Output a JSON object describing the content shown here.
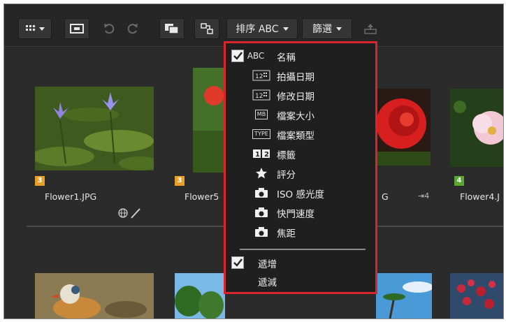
{
  "toolbar": {
    "sort_label": "排序 ABC",
    "filter_label": "篩選"
  },
  "sort_menu": {
    "options": [
      {
        "icon": "abc-icon",
        "icon_text": "ABC",
        "label": "名稱",
        "checked": true
      },
      {
        "icon": "calendar-icon",
        "icon_text": "12",
        "label": "拍攝日期",
        "checked": false
      },
      {
        "icon": "calendar-icon",
        "icon_text": "12",
        "label": "修改日期",
        "checked": false
      },
      {
        "icon": "filesize-icon",
        "icon_text": "MB",
        "label": "檔案大小",
        "checked": false
      },
      {
        "icon": "filetype-icon",
        "icon_text": "TYPE",
        "label": "檔案類型",
        "checked": false
      },
      {
        "icon": "label-icon",
        "icon_text": "12",
        "label": "標籤",
        "checked": false
      },
      {
        "icon": "star-icon",
        "icon_text": "",
        "label": "評分",
        "checked": false
      },
      {
        "icon": "camera-icon",
        "icon_text": "",
        "label": "ISO 感光度",
        "checked": false
      },
      {
        "icon": "camera-icon",
        "icon_text": "",
        "label": "快門速度",
        "checked": false
      },
      {
        "icon": "camera-icon",
        "icon_text": "",
        "label": "焦距",
        "checked": false
      }
    ],
    "order": [
      {
        "label": "遞增",
        "checked": true
      },
      {
        "label": "遞減",
        "checked": false
      }
    ]
  },
  "thumbnails": [
    {
      "name": "Flower1.JPG",
      "label_number": "3",
      "label_color": "#e8a02a"
    },
    {
      "name": "Flower5",
      "label_number": "3",
      "label_color": "#e8a02a"
    },
    {
      "name": "G",
      "extra": "⇥4",
      "label_number": "",
      "label_color": ""
    },
    {
      "name": "Flower4.J",
      "label_number": "4",
      "label_color": "#5aa832"
    }
  ],
  "colors": {
    "menu_border": "#d9262c",
    "background": "#2a2a2a"
  }
}
